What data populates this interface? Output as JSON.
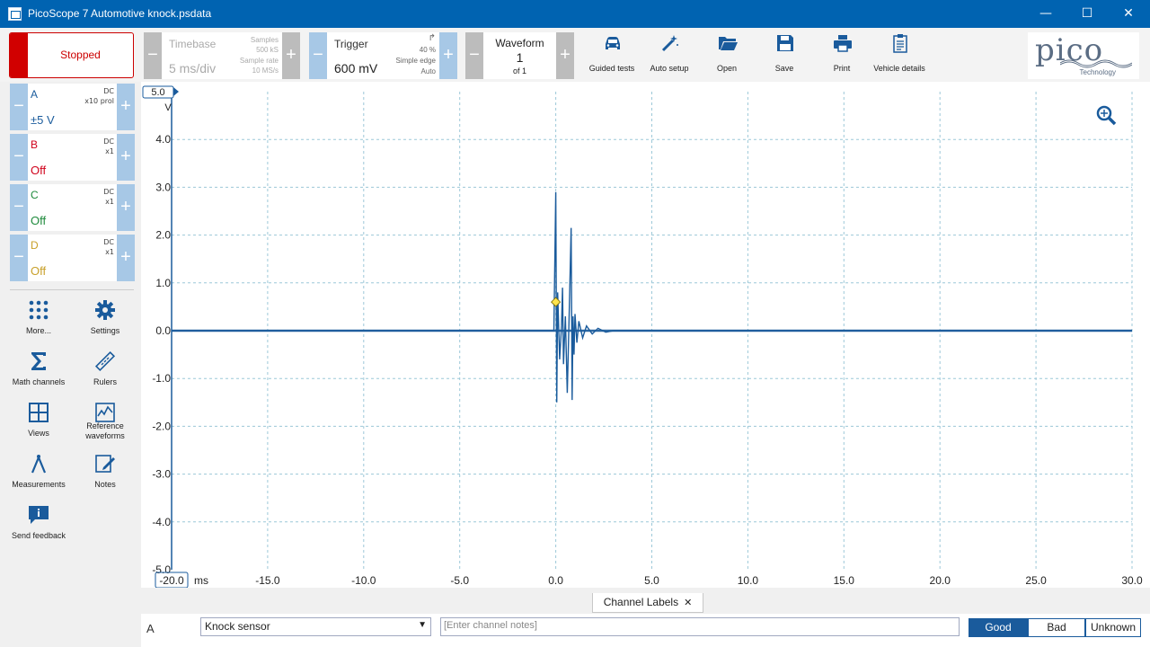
{
  "window": {
    "title": "PicoScope 7 Automotive knock.psdata"
  },
  "toolbar": {
    "stop_label": "Stopped",
    "timebase": {
      "label": "Timebase",
      "value": "5 ms/div",
      "samples_label": "Samples",
      "samples_value": "500 kS",
      "rate_label": "Sample rate",
      "rate_value": "10 MS/s"
    },
    "trigger": {
      "label": "Trigger",
      "value": "600 mV",
      "percent": "40 %",
      "type": "Simple edge",
      "mode": "Auto"
    },
    "waveform": {
      "label": "Waveform",
      "value": "1",
      "of": "of 1"
    },
    "buttons": [
      {
        "label": "Guided tests",
        "icon": "car-icon"
      },
      {
        "label": "Auto setup",
        "icon": "wand-icon"
      },
      {
        "label": "Open",
        "icon": "folder-icon"
      },
      {
        "label": "Save",
        "icon": "save-icon"
      },
      {
        "label": "Print",
        "icon": "printer-icon"
      },
      {
        "label": "Vehicle details",
        "icon": "clipboard-icon"
      }
    ],
    "logo": {
      "word": "pico",
      "sub": "Technology"
    }
  },
  "channels": [
    {
      "name": "A",
      "coupling": "DC",
      "probe": "x10 prol",
      "range": "±5 V",
      "color": "#1a5b9c"
    },
    {
      "name": "B",
      "coupling": "DC",
      "probe": "x1",
      "range": "Off",
      "color": "#d0021b"
    },
    {
      "name": "C",
      "coupling": "DC",
      "probe": "x1",
      "range": "Off",
      "color": "#1e8a3c"
    },
    {
      "name": "D",
      "coupling": "DC",
      "probe": "x1",
      "range": "Off",
      "color": "#c8a02a"
    }
  ],
  "tools": [
    {
      "label": "More...",
      "icon": "grid-dots-icon"
    },
    {
      "label": "Settings",
      "icon": "gear-icon"
    },
    {
      "label": "Math channels",
      "icon": "sigma-icon"
    },
    {
      "label": "Rulers",
      "icon": "ruler-icon"
    },
    {
      "label": "Views",
      "icon": "views-icon"
    },
    {
      "label": "Reference waveforms",
      "icon": "reference-waveform-icon"
    },
    {
      "label": "Measurements",
      "icon": "compass-icon"
    },
    {
      "label": "Notes",
      "icon": "notes-icon"
    },
    {
      "label": "Send feedback",
      "icon": "feedback-icon"
    }
  ],
  "chart_data": {
    "type": "line",
    "xlabel": "ms",
    "ylabel": "V",
    "xlim": [
      -20,
      30
    ],
    "ylim": [
      -5,
      5
    ],
    "x_ticks": [
      "-20.0",
      "-15.0",
      "-10.0",
      "-5.0",
      "0.0",
      "5.0",
      "10.0",
      "15.0",
      "20.0",
      "25.0",
      "30.0"
    ],
    "y_ticks": [
      "5.0",
      "4.0",
      "3.0",
      "2.0",
      "1.0",
      "0.0",
      "-1.0",
      "-2.0",
      "-3.0",
      "-4.0",
      "-5.0"
    ],
    "grid": true,
    "series": [
      {
        "color": "#1a5b9c",
        "x": [
          -20,
          -0.1,
          0.0,
          0.05,
          0.1,
          0.2,
          0.3,
          0.35,
          0.4,
          0.5,
          0.6,
          0.7,
          0.8,
          0.85,
          0.9,
          0.95,
          1.0,
          1.1,
          1.2,
          1.4,
          1.6,
          1.9,
          2.2,
          2.6,
          3.0,
          30
        ],
        "y": [
          0,
          0,
          2.9,
          -1.5,
          0.8,
          -0.6,
          0.1,
          0.9,
          -0.7,
          0.3,
          -1.3,
          0.4,
          2.15,
          -1.45,
          0.3,
          -0.5,
          0.35,
          -0.25,
          0.2,
          -0.15,
          0.1,
          -0.07,
          0.05,
          -0.03,
          0,
          0
        ]
      }
    ],
    "trigger_marker": {
      "x": 0.0,
      "y": 0.6
    }
  },
  "channel_labels": {
    "tab": "Channel Labels",
    "row_channel": "A",
    "sensor": "Knock sensor",
    "notes_placeholder": "[Enter channel notes]",
    "ratings": [
      "Good",
      "Bad",
      "Unknown"
    ],
    "selected": "Good"
  }
}
